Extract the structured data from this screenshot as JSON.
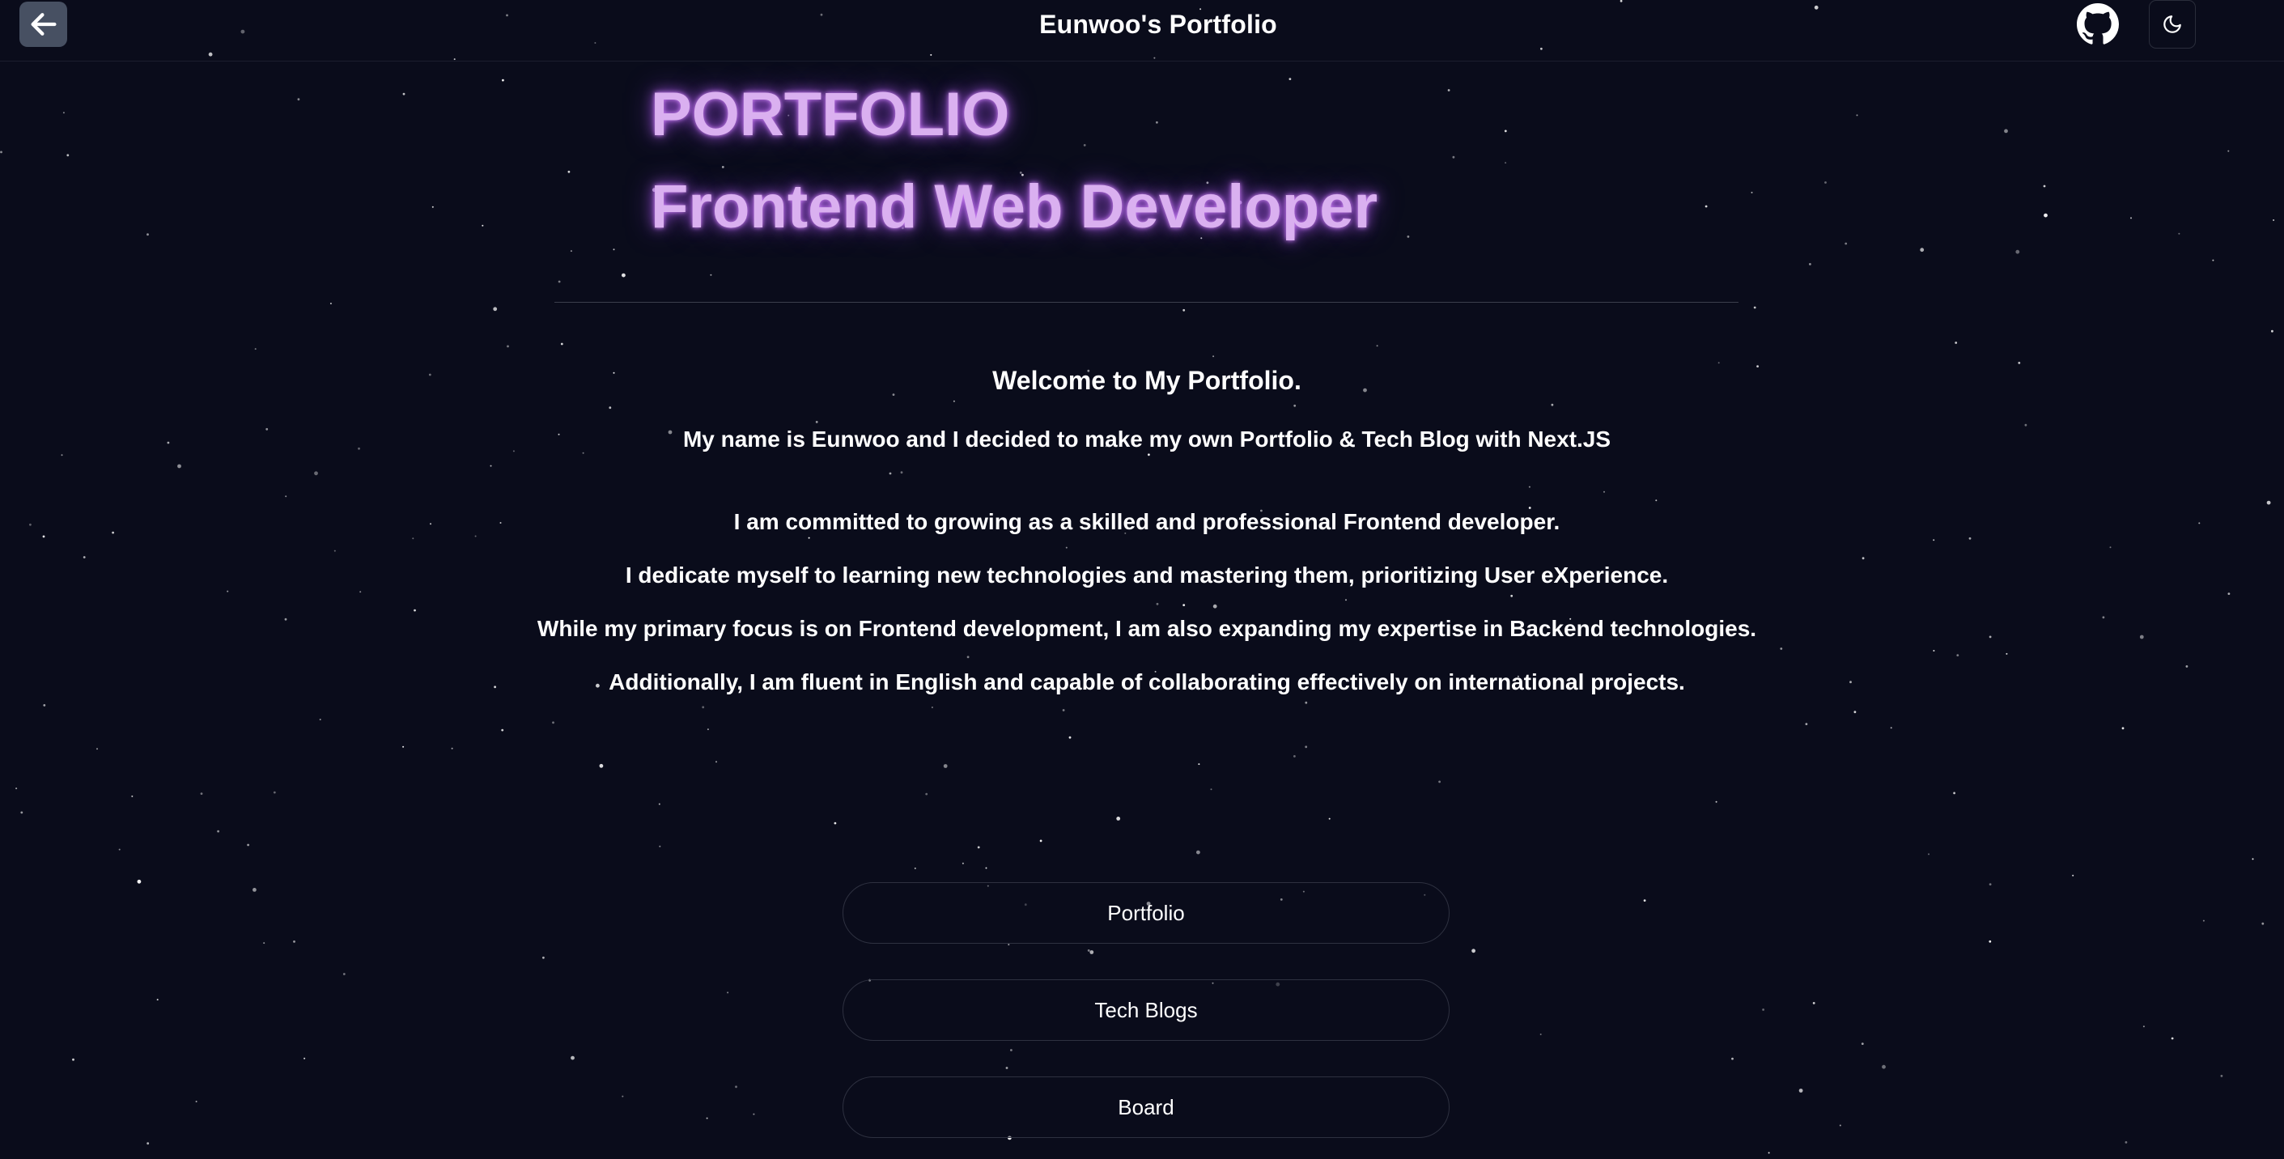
{
  "header": {
    "title": "Eunwoo's Portfolio",
    "back_icon": "arrow-left-icon",
    "github_icon": "github-icon",
    "theme_icon": "moon-icon"
  },
  "hero": {
    "line1": "PORTFOLIO",
    "line2": "Frontend Web Developer",
    "glow_color": "#c77dff"
  },
  "intro": {
    "welcome": "Welcome to My Portfolio.",
    "line1": "My name is Eunwoo and I decided to make my own Portfolio & Tech Blog with Next.JS",
    "line2": "I am committed to growing as a skilled and professional Frontend developer.",
    "line3": "I dedicate myself to learning new technologies and mastering them, prioritizing User eXperience.",
    "line4": "While my primary focus is on Frontend development, I am also expanding my expertise in Backend technologies.",
    "line5": "Additionally, I am fluent in English and capable of collaborating effectively on international projects."
  },
  "nav": {
    "portfolio": "Portfolio",
    "tech_blogs": "Tech Blogs",
    "board": "Board"
  },
  "colors": {
    "background": "#0a0c1b",
    "text": "#ffffff",
    "back_button_bg": "#475062"
  }
}
